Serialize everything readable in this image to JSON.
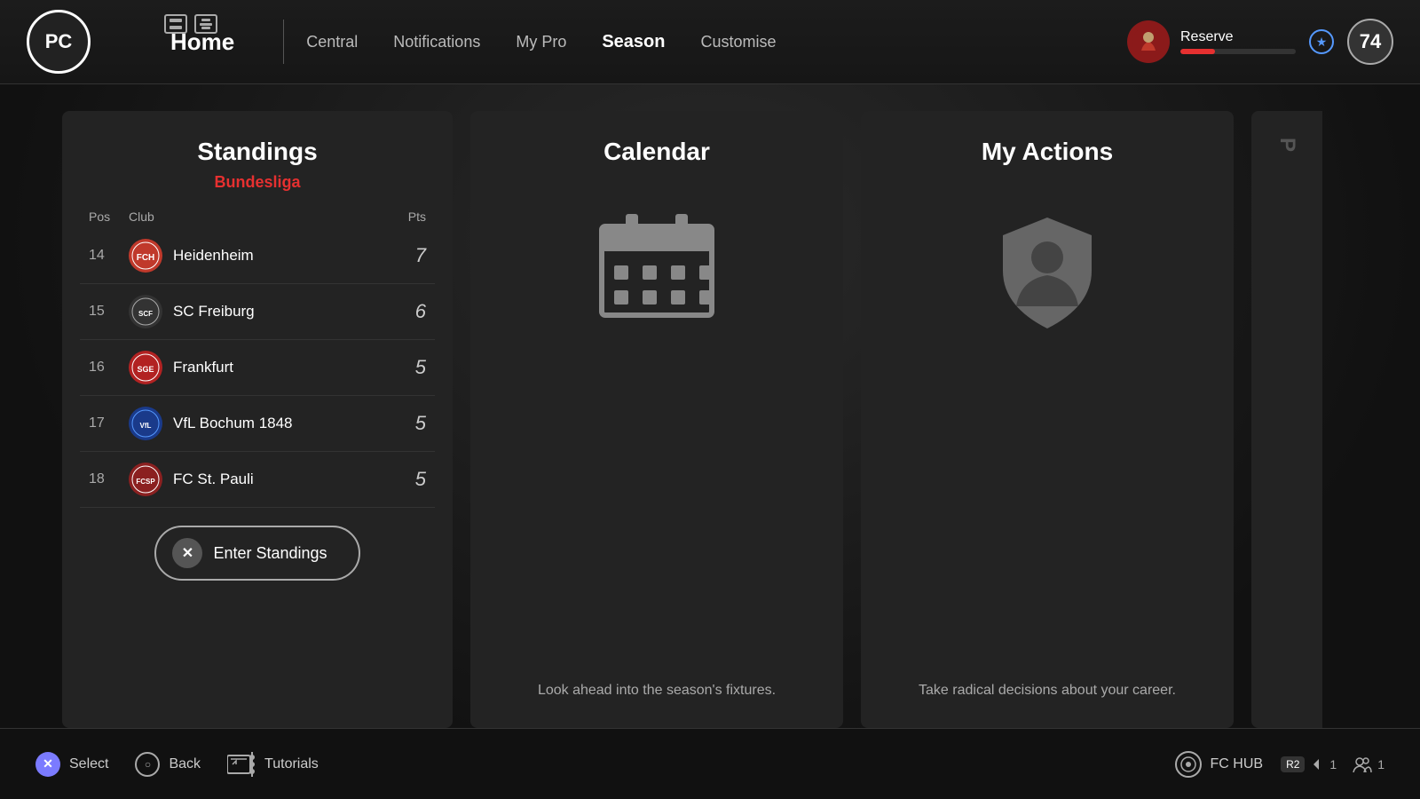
{
  "app": {
    "logo": "PC",
    "nav": {
      "home": "Home",
      "items": [
        {
          "id": "central",
          "label": "Central",
          "active": false
        },
        {
          "id": "notifications",
          "label": "Notifications",
          "active": false
        },
        {
          "id": "mypro",
          "label": "My Pro",
          "active": false
        },
        {
          "id": "season",
          "label": "Season",
          "active": true
        },
        {
          "id": "customise",
          "label": "Customise",
          "active": false
        }
      ]
    },
    "player": {
      "status": "Reserve",
      "rating": "74",
      "bar_pct": 30
    }
  },
  "standings": {
    "title": "Standings",
    "league": "Bundesliga",
    "table_headers": {
      "pos": "Pos",
      "club": "Club",
      "pts": "Pts"
    },
    "rows": [
      {
        "pos": "14",
        "club": "Heidenheim",
        "pts": "7",
        "color": "#c0392b"
      },
      {
        "pos": "15",
        "club": "SC Freiburg",
        "pts": "6",
        "color": "#555"
      },
      {
        "pos": "16",
        "club": "Frankfurt",
        "pts": "5",
        "color": "#c0392b"
      },
      {
        "pos": "17",
        "club": "VfL Bochum 1848",
        "pts": "5",
        "color": "#1a3a8a"
      },
      {
        "pos": "18",
        "club": "FC St. Pauli",
        "pts": "5",
        "color": "#8B2020"
      }
    ],
    "enter_button": "Enter Standings"
  },
  "calendar": {
    "title": "Calendar",
    "description": "Look ahead into the season's fixtures."
  },
  "my_actions": {
    "title": "My Actions",
    "description": "Take radical decisions about your career."
  },
  "bottom_bar": {
    "select_label": "Select",
    "back_label": "Back",
    "tutorials_label": "Tutorials",
    "fc_hub_label": "FC HUB",
    "r2_label": "R2",
    "arrow_count": "1",
    "people_count": "1"
  }
}
